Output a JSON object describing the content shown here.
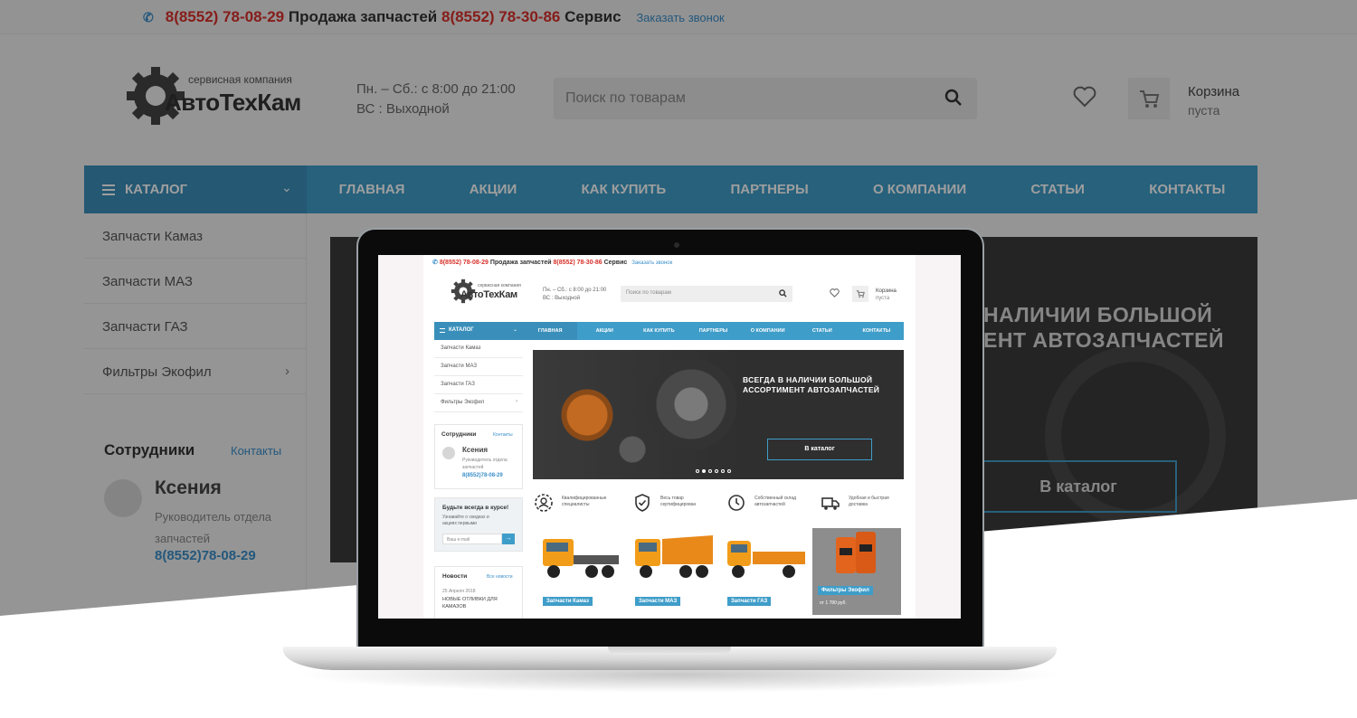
{
  "top_bar": {
    "phone_sales": "8(8552) 78-08-29",
    "sales_label": "Продажа запчастей",
    "phone_service": "8(8552) 78-30-86",
    "service_label": "Сервис",
    "callback_link": "Заказать звонок"
  },
  "brand": {
    "tagline": "сервисная компания",
    "name": "АвтоТехКам"
  },
  "hours": {
    "weekdays": "Пн. – Сб.: с 8:00 до 21:00",
    "sunday": "ВС : Выходной"
  },
  "search": {
    "placeholder": "Поиск по товарам"
  },
  "cart": {
    "label": "Корзина",
    "status": "пуста"
  },
  "nav": {
    "catalog": "КАТАЛОГ",
    "items": [
      "ГЛАВНАЯ",
      "АКЦИИ",
      "КАК КУПИТЬ",
      "ПАРТНЕРЫ",
      "О КОМПАНИИ",
      "СТАТЬИ",
      "КОНТАКТЫ"
    ]
  },
  "sidebar": {
    "items": [
      "Запчасти Камаз",
      "Запчасти МАЗ",
      "Запчасти ГАЗ",
      "Фильтры Экофил"
    ]
  },
  "staff": {
    "title": "Сотрудники",
    "link": "Контакты",
    "name": "Ксения",
    "role": "Руководитель отдела запчастей",
    "role_line1": "Руководитель отдела",
    "role_line2": "запчастей",
    "phone": "8(8552)78-08-29"
  },
  "banner": {
    "line1": "ВСЕГДА В НАЛИЧИИ БОЛЬШОЙ",
    "line2": "АССОРТИМЕНТ АВТОЗАПЧАСТЕЙ",
    "bg_line1": "НАЛИЧИИ БОЛЬШОЙ",
    "bg_line2": "ЕНТ АВТОЗАПЧАСТЕЙ",
    "button": "В каталог",
    "slides": 6,
    "active_slide": 2
  },
  "subscribe": {
    "title": "Будьте всегда в курсе!",
    "text_line1": "Узнавайте о скидках и",
    "text_line2": "акциях первыми",
    "placeholder": "Ваш e-mail"
  },
  "news": {
    "title": "Новости",
    "link": "Все новости",
    "date": "25 Апреля 2018",
    "headline_line1": "НОВЫЕ ОТЛИВКИ ДЛЯ",
    "headline_line2": "КАМАЗОВ"
  },
  "features": [
    {
      "icon": "users-gear-icon",
      "line1": "Квалифицированные",
      "line2": "специалисты"
    },
    {
      "icon": "shield-check-icon",
      "line1": "Весь товар",
      "line2": "сертифицирован"
    },
    {
      "icon": "clock-icon",
      "line1": "Собственный склад",
      "line2": "автозапчастей"
    },
    {
      "icon": "truck-icon",
      "line1": "Удобная и быстрая",
      "line2": "доставка"
    }
  ],
  "products": [
    {
      "label": "Запчасти Камаз"
    },
    {
      "label": "Запчасти МАЗ"
    },
    {
      "label": "Запчасти ГАЗ"
    },
    {
      "label": "Фильтры Экофил",
      "price": "от 1 780 руб."
    }
  ],
  "colors": {
    "accent": "#3f9dc9",
    "phone_red": "#d8302a",
    "banner_bg": "#2f2f2f"
  }
}
